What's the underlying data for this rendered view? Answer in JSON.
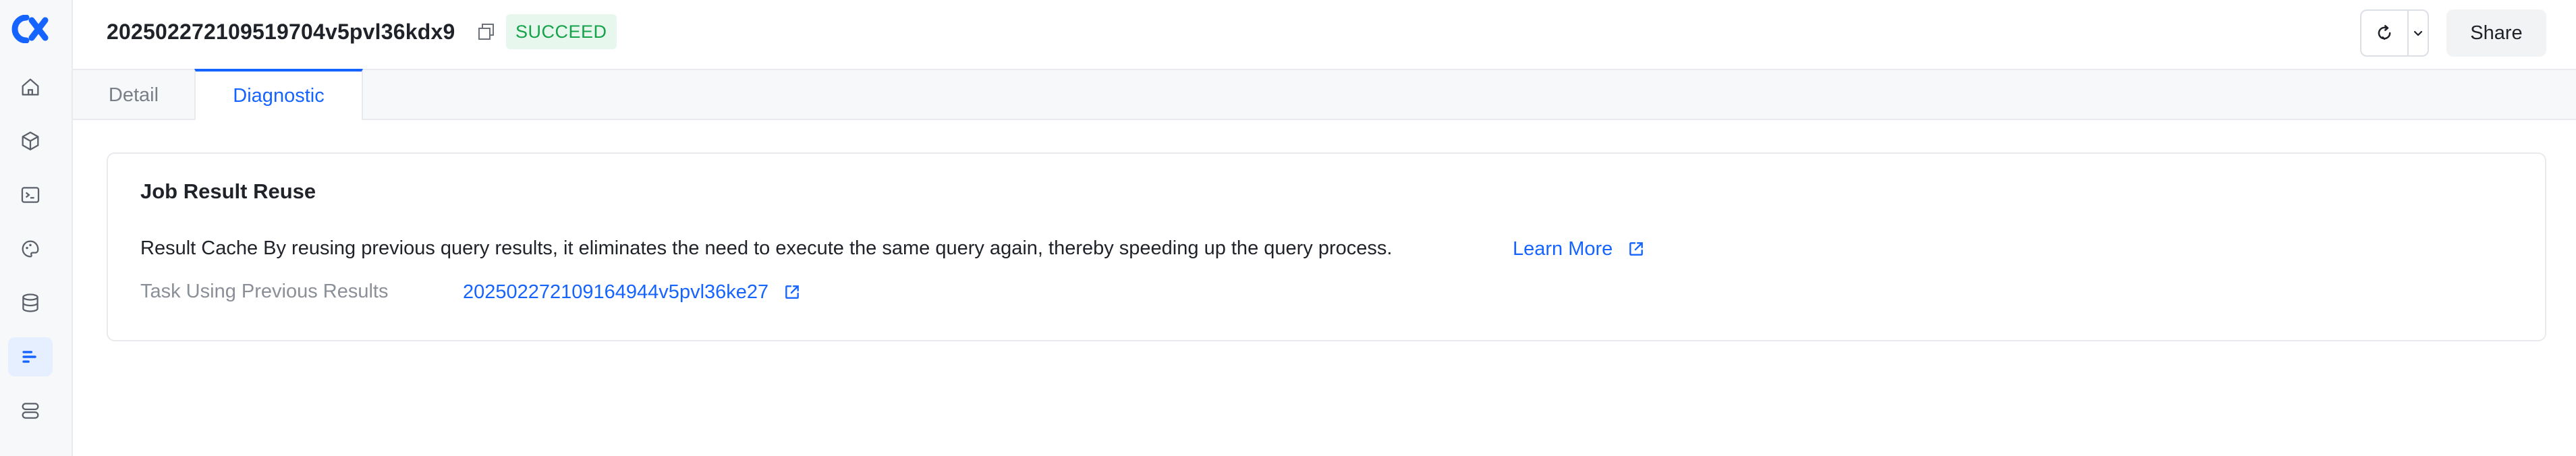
{
  "sidebar": {
    "items": [
      {
        "icon": "home-icon"
      },
      {
        "icon": "cube-icon"
      },
      {
        "icon": "terminal-icon"
      },
      {
        "icon": "palette-icon"
      },
      {
        "icon": "database-icon"
      },
      {
        "icon": "jobs-icon",
        "active": true
      },
      {
        "icon": "server-icon"
      }
    ]
  },
  "header": {
    "job_id": "202502272109519704v5pvl36kdx9",
    "status": "SUCCEED",
    "share_label": "Share"
  },
  "tabs": [
    {
      "label": "Detail",
      "active": false
    },
    {
      "label": "Diagnostic",
      "active": true
    }
  ],
  "card": {
    "title": "Job Result Reuse",
    "description": "Result Cache By reusing previous query results, it eliminates the need to execute the same query again, thereby speeding up the query process.",
    "learn_more": "Learn More",
    "previous_label": "Task Using Previous Results",
    "previous_task_id": "202502272109164944v5pvl36ke27"
  },
  "colors": {
    "accent": "#1664ff",
    "success_text": "#15a34a",
    "success_bg": "#e8f7ee"
  }
}
